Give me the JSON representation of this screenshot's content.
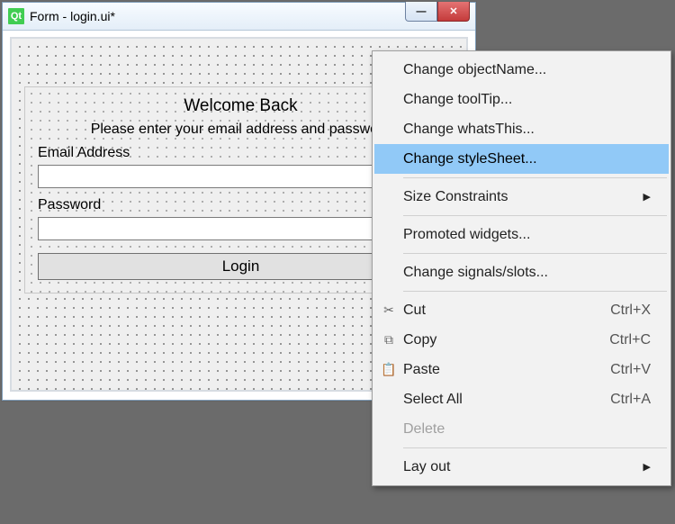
{
  "window": {
    "icon_text": "Qt",
    "title": "Form - login.ui*",
    "minimize_glyph": "—",
    "close_glyph": "✕"
  },
  "form": {
    "heading": "Welcome Back",
    "subtitle": "Please enter your email address and password",
    "email_label": "Email Address",
    "email_value": "",
    "password_label": "Password",
    "password_value": "",
    "login_label": "Login"
  },
  "menu": {
    "items": [
      {
        "label": "Change objectName..."
      },
      {
        "label": "Change toolTip..."
      },
      {
        "label": "Change whatsThis..."
      },
      {
        "label": "Change styleSheet...",
        "highlight": true
      },
      {
        "label": "Size Constraints",
        "arrow": true
      },
      {
        "label": "Promoted widgets..."
      },
      {
        "label": "Change signals/slots..."
      },
      {
        "label": "Cut",
        "shortcut": "Ctrl+X",
        "icon": "✂"
      },
      {
        "label": "Copy",
        "shortcut": "Ctrl+C",
        "icon": "⧉"
      },
      {
        "label": "Paste",
        "shortcut": "Ctrl+V",
        "icon": "📋"
      },
      {
        "label": "Select All",
        "shortcut": "Ctrl+A"
      },
      {
        "label": "Delete",
        "disabled": true
      },
      {
        "label": "Lay out",
        "arrow": true
      }
    ],
    "separators_after": [
      3,
      4,
      5,
      6,
      11
    ]
  }
}
